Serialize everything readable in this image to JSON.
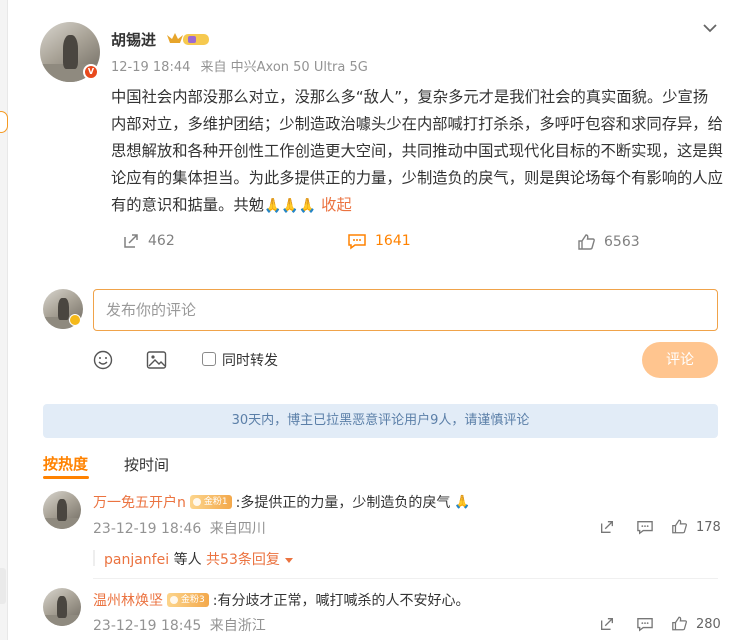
{
  "post": {
    "author": "胡锡进",
    "time": "12-19 18:44",
    "source": "来自 中兴Axon 50 Ultra 5G",
    "text": "中国社会内部没那么对立，没那么多“敌人”，复杂多元才是我们社会的真实面貌。少宣扬内部对立，多维护团结；少制造政治噱头少在内部喊打打杀杀，多呼吁包容和求同存异，给思想解放和各种开创性工作创造更大空间，共同推动中国式现代化目标的不断实现，这是舆论应有的集体担当。为此多提供正的力量，少制造负的戾气，则是舆论场每个有影响的人应有的意识和掂量。共勉",
    "collapse_label": "收起",
    "reposts": "462",
    "comments": "1641",
    "likes": "6563",
    "colors": {
      "accent": "#ff8200",
      "link": "#eb7340"
    },
    "icons": [
      "repost-icon",
      "comment-icon",
      "like-icon",
      "chevron-down-icon",
      "fold-hands-icon",
      "crown-badge-icon",
      "verified-badge-icon"
    ]
  },
  "composer": {
    "placeholder": "发布你的评论",
    "forward_label": "同时转发",
    "submit_label": "评论",
    "icons": [
      "emoji-icon",
      "image-icon"
    ]
  },
  "notice": "30天内，博主已拉黑恶意评论用户9人，请谨慎评论",
  "sort": {
    "hot": "按热度",
    "time": "按时间"
  },
  "comments": [
    {
      "name": "万一免五开户n",
      "fan": "金粉1",
      "text": ":多提供正的力量，少制造负的戾气",
      "time": "23-12-19 18:46",
      "location": "来自四川",
      "likes": "178",
      "reply_user": "panjanfei",
      "reply_others": "等人",
      "reply_more": "共53条回复"
    },
    {
      "name": "温州林焕坚",
      "fan": "金粉3",
      "text": ":有分歧才正常，喊打喊杀的人不安好心。",
      "time": "23-12-19 18:45",
      "location": "来自浙江",
      "likes": "280"
    }
  ]
}
